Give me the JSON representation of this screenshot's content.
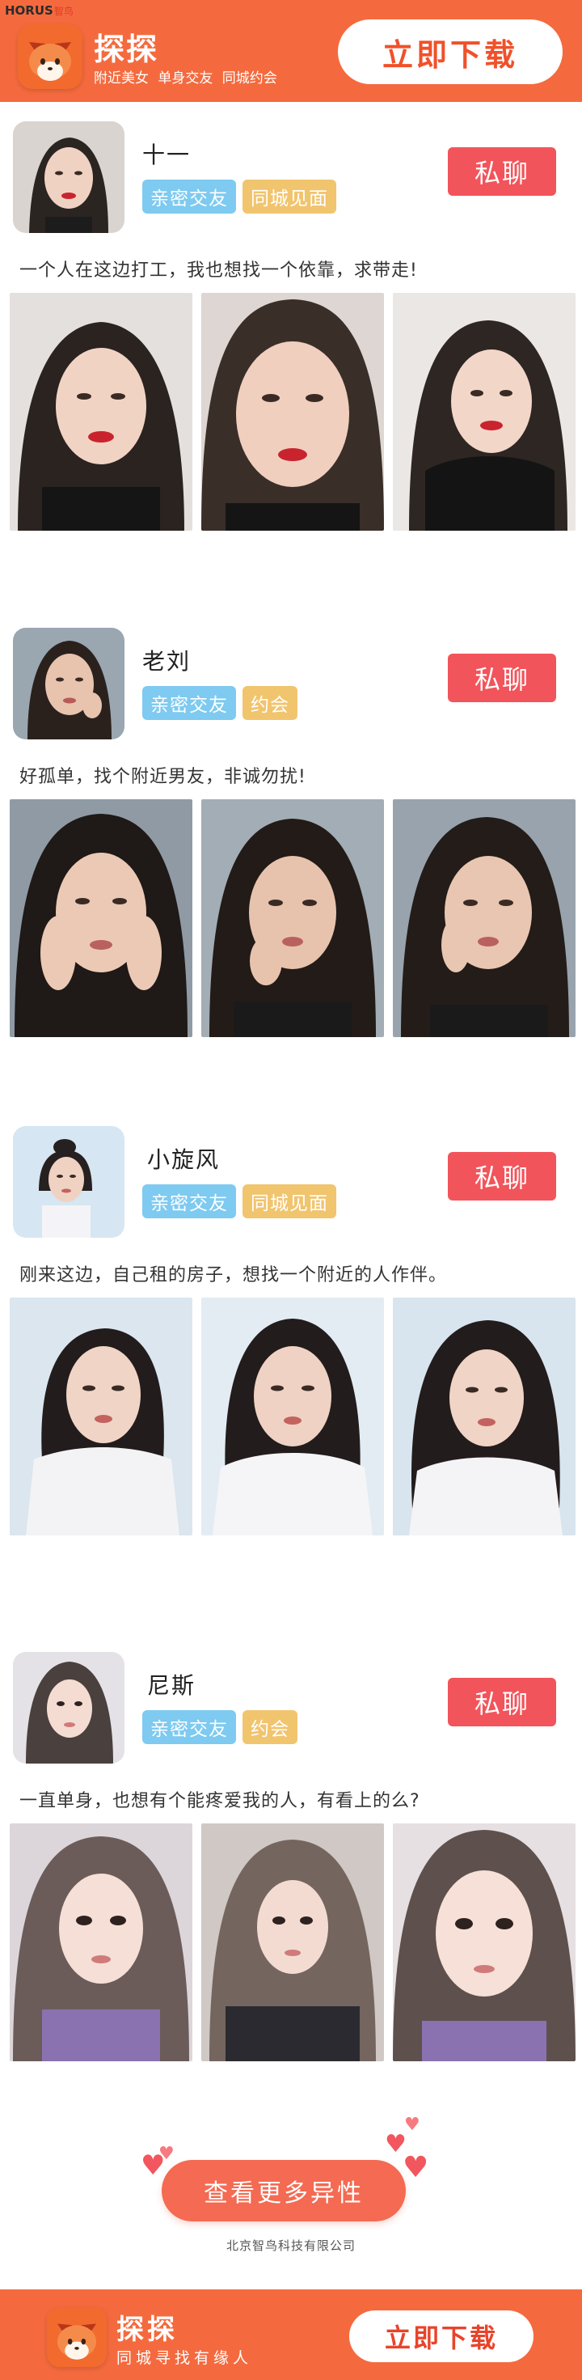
{
  "watermark": {
    "brand": "HORUS",
    "sub": "智鸟"
  },
  "header": {
    "app_name": "探探",
    "tagline": "附近美女 单身交友 同城约会",
    "download_label": "立即下载"
  },
  "profiles": [
    {
      "name": "十一",
      "tags": [
        "亲密交友",
        "同城见面"
      ],
      "chat_label": "私聊",
      "bio": "一个人在这边打工，我也想找一个依靠，求带走!"
    },
    {
      "name": "老刘",
      "tags": [
        "亲密交友",
        "约会"
      ],
      "chat_label": "私聊",
      "bio": "好孤单，找个附近男友，非诚勿扰!"
    },
    {
      "name": "小旋风",
      "tags": [
        "亲密交友",
        "同城见面"
      ],
      "chat_label": "私聊",
      "bio": "刚来这边，自己租的房子，想找一个附近的人作伴。"
    },
    {
      "name": "尼斯",
      "tags": [
        "亲密交友",
        "约会"
      ],
      "chat_label": "私聊",
      "bio": "一直单身，也想有个能疼爱我的人，有看上的么?"
    }
  ],
  "more_button": "查看更多异性",
  "company": "北京智鸟科技有限公司",
  "footer": {
    "app_name": "探探",
    "tagline": "同城寻找有缘人",
    "download_label": "立即下载"
  },
  "colors": {
    "brand_orange": "#f46a3e",
    "chat_red": "#f2545b",
    "tag_blue": "#7ecaf0",
    "tag_gold": "#f1c46e"
  }
}
